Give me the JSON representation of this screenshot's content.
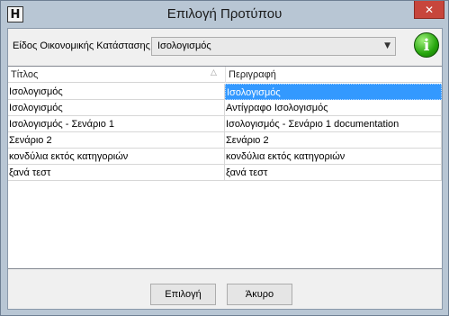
{
  "window": {
    "title": "Επιλογή Προτύπου",
    "app_icon_glyph": "H",
    "close_glyph": "✕"
  },
  "filter": {
    "label": "Είδος Οικονομικής Κατάστασης",
    "selected": "Ισολογισμός",
    "info_glyph": "i"
  },
  "grid": {
    "columns": [
      "Τίτλος",
      "Περιγραφή"
    ],
    "sort_glyph": "△",
    "rows": [
      [
        "Ισολογισμός",
        "Ισολογισμός"
      ],
      [
        "Ισολογισμός",
        "Αντίγραφο Ισολογισμός"
      ],
      [
        "Ισολογισμός - Σενάριο 1",
        "Ισολογισμός - Σενάριο 1 documentation"
      ],
      [
        "Σενάριο 2",
        "Σενάριο 2"
      ],
      [
        "κονδύλια εκτός κατηγοριών",
        "κονδύλια εκτός κατηγοριών"
      ],
      [
        "ξανά τεστ",
        "ξανά τεστ"
      ]
    ],
    "selected_row": 0
  },
  "buttons": {
    "select": "Επιλογή",
    "cancel": "Άκυρο"
  },
  "colors": {
    "selection": "#3399ff",
    "close_button": "#c7463c",
    "info_icon": "#26a50d"
  }
}
